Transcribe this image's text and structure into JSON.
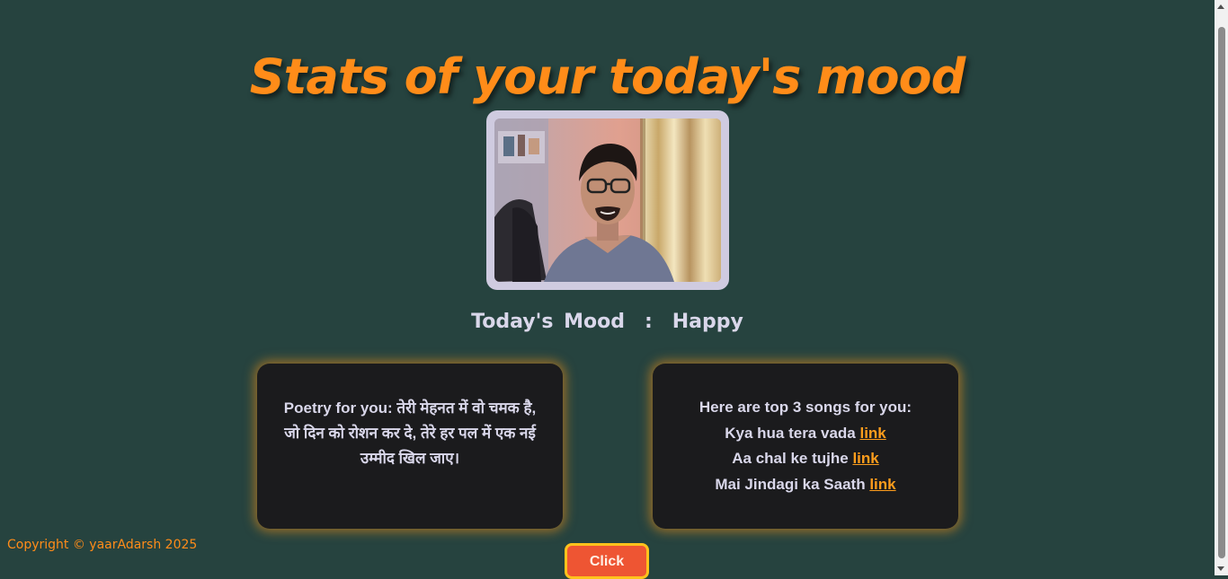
{
  "page": {
    "title": "Stats of your today's mood"
  },
  "photo": {
    "icon": "webcam-capture-image"
  },
  "mood": {
    "label": "Today's Mood",
    "separator": ":",
    "value": "Happy"
  },
  "poetry": {
    "text": "Poetry for you: तेरी मेहनत में वो चमक है, जो दिन को रोशन कर दे, तेरे हर पल में एक नई उम्मीद खिल जाए।"
  },
  "songs": {
    "heading": "Here are top 3 songs for you:",
    "items": [
      {
        "title": "Kya hua tera vada",
        "link_label": "link"
      },
      {
        "title": "Aa chal ke tujhe",
        "link_label": "link"
      },
      {
        "title": "Mai Jindagi ka Saath",
        "link_label": "link"
      }
    ]
  },
  "footer": {
    "copyright": "Copyright © yaarAdarsh 2025"
  },
  "button": {
    "label": "Click"
  },
  "colors": {
    "background": "#26433f",
    "accent": "#ff8c19",
    "card": "#1b1b1d",
    "button": "#ee5533"
  }
}
